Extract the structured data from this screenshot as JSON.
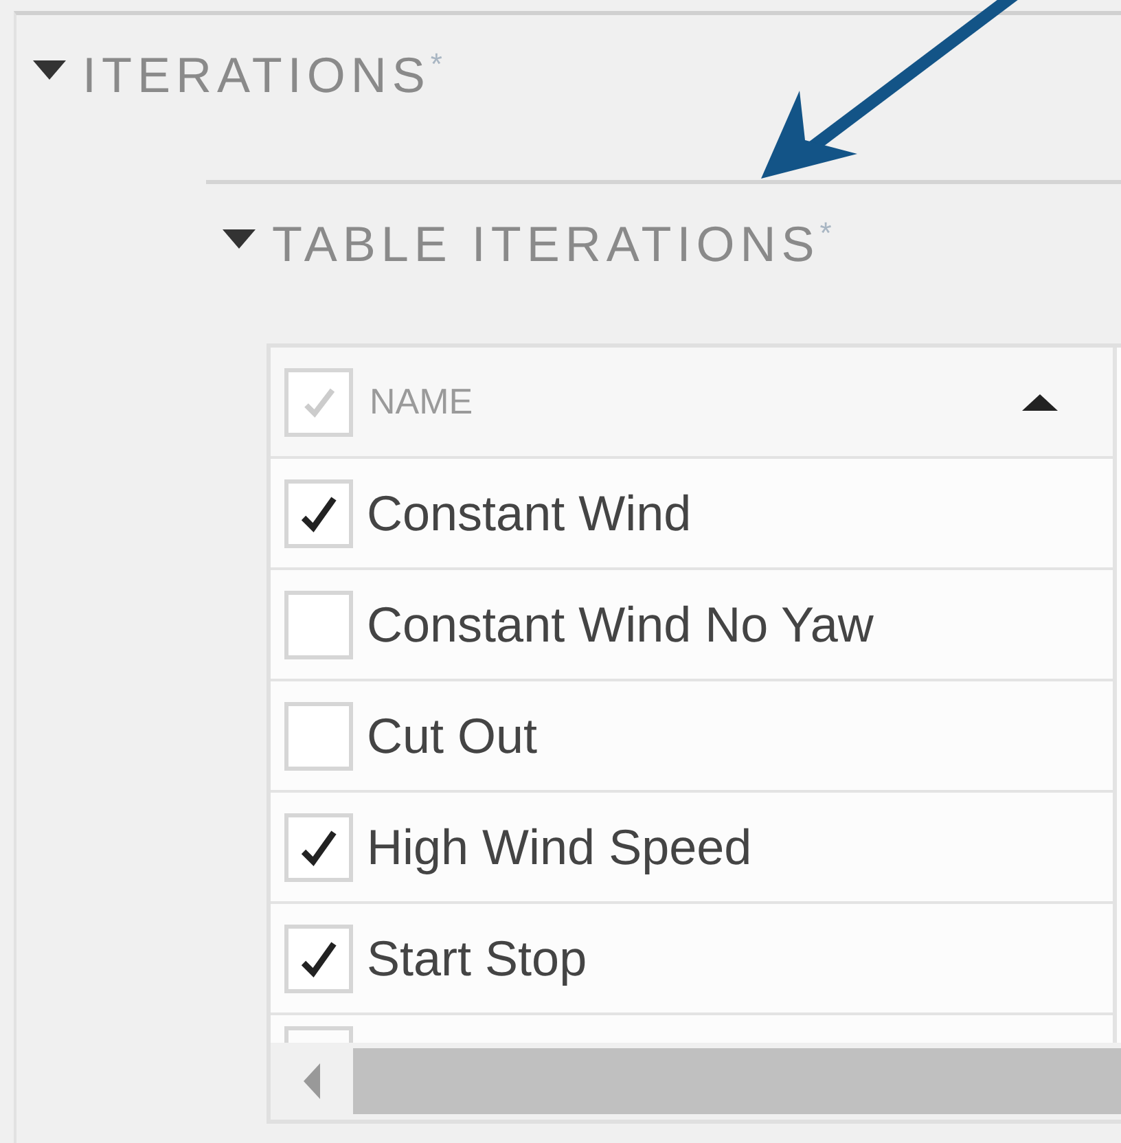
{
  "section": {
    "title": "ITERATIONS$^{*}$",
    "expanded": true,
    "subsection": {
      "title": "TABLE ITERATIONS$^{*}$",
      "expanded": true,
      "table": {
        "header": {
          "label": "NAME",
          "checked": true,
          "sort_ascending": true
        },
        "rows": [
          {
            "name": "Constant Wind",
            "checked": true
          },
          {
            "name": "Constant Wind No Yaw",
            "checked": false
          },
          {
            "name": "Cut Out",
            "checked": false
          },
          {
            "name": "High Wind Speed",
            "checked": true
          },
          {
            "name": "Start Stop",
            "checked": true
          }
        ],
        "partial_row": {
          "checked": false
        }
      }
    }
  }
}
